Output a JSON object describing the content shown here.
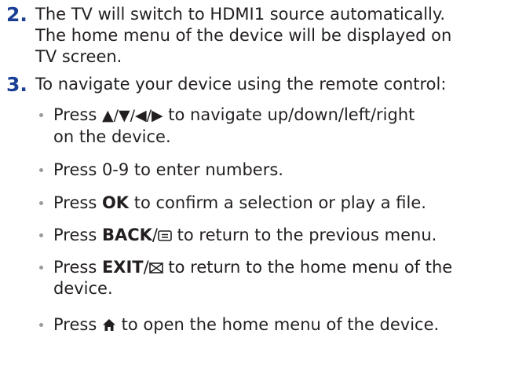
{
  "step2": {
    "number": "2.",
    "line1": "The TV will switch to HDMI1 source automatically.",
    "line2": "The home menu of the device will be displayed on",
    "line3": "TV screen."
  },
  "step3": {
    "number": "3.",
    "text": "To navigate your device using the remote control:"
  },
  "bullets": {
    "b1": {
      "prefix": "Press ",
      "arrows": "▲/▼/◀/▶",
      "suffix": " to navigate up/down/left/right",
      "line2": "on the device."
    },
    "b2": {
      "text": "Press 0-9 to enter numbers."
    },
    "b3": {
      "prefix": "Press ",
      "bold": "OK",
      "suffix": " to confirm a selection or play a file."
    },
    "b4": {
      "prefix": "Press ",
      "bold": "BACK",
      "slash": "/",
      "suffix": " to return to the previous menu."
    },
    "b5": {
      "prefix": "Press ",
      "bold": "EXIT",
      "slash": "/",
      "suffix": " to return to the home menu of the",
      "line2": "device."
    },
    "b6": {
      "prefix": "Press ",
      "suffix": " to open the home menu of the device."
    }
  },
  "colors": {
    "step_number": "#1b3f94",
    "text": "#231f20",
    "bullet": "#9a9a9a"
  },
  "icons": {
    "back": "back-menu-icon",
    "exit": "exit-envelope-icon",
    "home": "home-icon"
  }
}
